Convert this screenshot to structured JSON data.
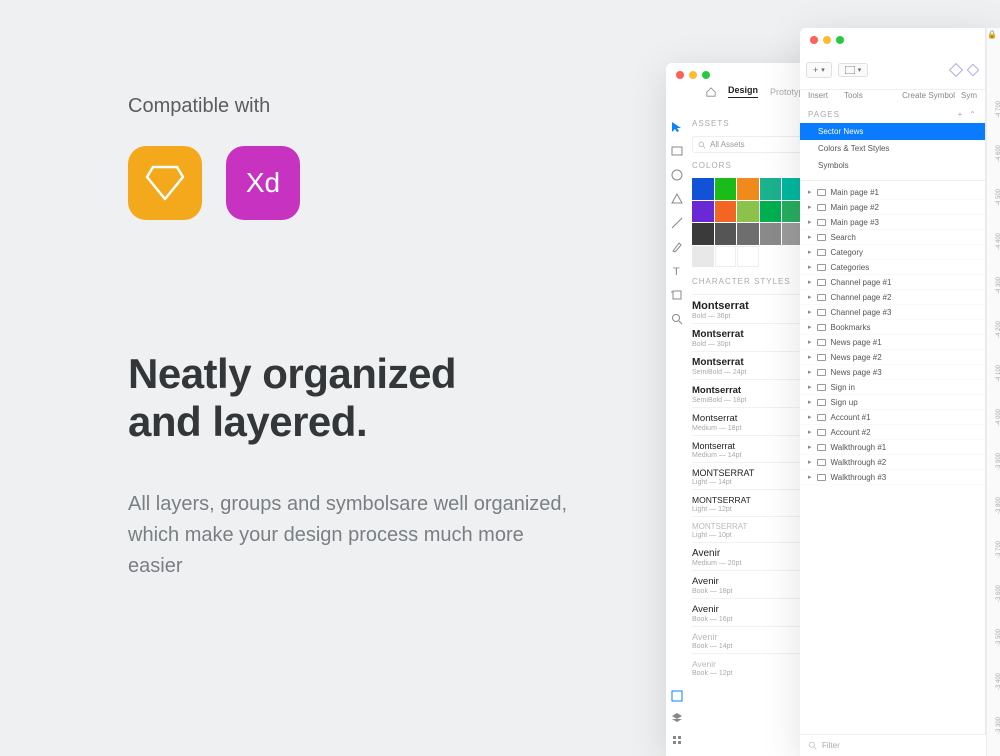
{
  "promo": {
    "compat_label": "Compatible with",
    "headline_l1": "Neatly organized",
    "headline_l2": "and layered.",
    "subtext": "All layers, groups and symbolsare well organized, which make your design process much more easier",
    "apps": {
      "sketch": "Sketch",
      "xd": "Xd"
    }
  },
  "figma_panel": {
    "tabs": {
      "home": "home",
      "design": "Design",
      "prototype": "Prototype"
    },
    "tools": [
      "move",
      "frame",
      "ellipse",
      "polygon",
      "line",
      "pen",
      "text",
      "hand",
      "zoom"
    ],
    "assets_header": "ASSETS",
    "search": {
      "placeholder": "All Assets"
    },
    "colors_header": "Colors",
    "swatches": [
      "#1152d6",
      "#1abc1a",
      "#f08a1c",
      "#1bb28e",
      "#00b8a0",
      "#22a7f0",
      "#6a29d4",
      "#f26522",
      "#8bc34a",
      "#00b050",
      "#27ae60",
      "#0f6bd6",
      "#3a3a3a",
      "#555555",
      "#6e6e6e",
      "#8a8a8a",
      "#9c9c9c",
      "#bdbdbd",
      "#e8e8e8",
      "#ffffff",
      "#ffffff"
    ],
    "char_styles_header": "Character Styles",
    "char_styles": [
      {
        "name": "Montserrat",
        "meta": "Bold — 36pt",
        "weight": "700",
        "size": "11px"
      },
      {
        "name": "Montserrat",
        "meta": "Bold — 30pt",
        "weight": "700",
        "size": "10px"
      },
      {
        "name": "Montserrat",
        "meta": "SemiBold — 24pt",
        "weight": "600",
        "size": "10px"
      },
      {
        "name": "Montserrat",
        "meta": "SemiBold — 18pt",
        "weight": "600",
        "size": "9.5px"
      },
      {
        "name": "Montserrat",
        "meta": "Medium — 18pt",
        "weight": "500",
        "size": "9.5px"
      },
      {
        "name": "Montserrat",
        "meta": "Medium — 14pt",
        "weight": "500",
        "size": "9px"
      },
      {
        "name": "MONTSERRAT",
        "meta": "Light — 14pt",
        "weight": "300",
        "size": "9px"
      },
      {
        "name": "MONTSERRAT",
        "meta": "Light — 12pt",
        "weight": "300",
        "size": "8.5px"
      },
      {
        "name": "MONTSERRAT",
        "meta": "Light — 10pt",
        "weight": "300",
        "size": "8px",
        "fade": true
      },
      {
        "name": "Avenir",
        "meta": "Medium — 20pt",
        "weight": "500",
        "size": "10px",
        "ff": "Avenir"
      },
      {
        "name": "Avenir",
        "meta": "Book — 18pt",
        "weight": "400",
        "size": "9.5px",
        "ff": "Avenir"
      },
      {
        "name": "Avenir",
        "meta": "Book — 16pt",
        "weight": "400",
        "size": "9.5px",
        "ff": "Avenir"
      },
      {
        "name": "Avenir",
        "meta": "Book — 14pt",
        "weight": "400",
        "size": "9px",
        "ff": "Avenir",
        "fade": true
      },
      {
        "name": "Avenir",
        "meta": "Book — 12pt",
        "weight": "400",
        "size": "8.5px",
        "ff": "Avenir",
        "fade": true
      }
    ]
  },
  "sketch_panel": {
    "toolbar": {
      "insert": "Insert",
      "tools": "Tools",
      "create_symbol": "Create Symbol",
      "sym": "Sym"
    },
    "pages_header": "PAGES",
    "pages": [
      {
        "label": "Sector News",
        "selected": true
      },
      {
        "label": "Colors & Text Styles"
      },
      {
        "label": "Symbols"
      }
    ],
    "layers": [
      "Main page #1",
      "Main page #2",
      "Main page #3",
      "Search",
      "Category",
      "Categories",
      "Channel page #1",
      "Channel page #2",
      "Channel page #3",
      "Bookmarks",
      "News page #1",
      "News page #2",
      "News page #3",
      "Sign in",
      "Sign up",
      "Account #1",
      "Account #2",
      "Walkthrough #1",
      "Walkthrough #2",
      "Walkthrough #3"
    ],
    "filter_label": "Filter",
    "ruler_ticks": [
      "-4 700",
      "-4 600",
      "-4 500",
      "-4 400",
      "-4 300",
      "-4 200",
      "-4 100",
      "-4 000",
      "-3 900",
      "-3 800",
      "-3 700",
      "-3 600",
      "-3 500",
      "-3 400",
      "-3 300"
    ]
  }
}
